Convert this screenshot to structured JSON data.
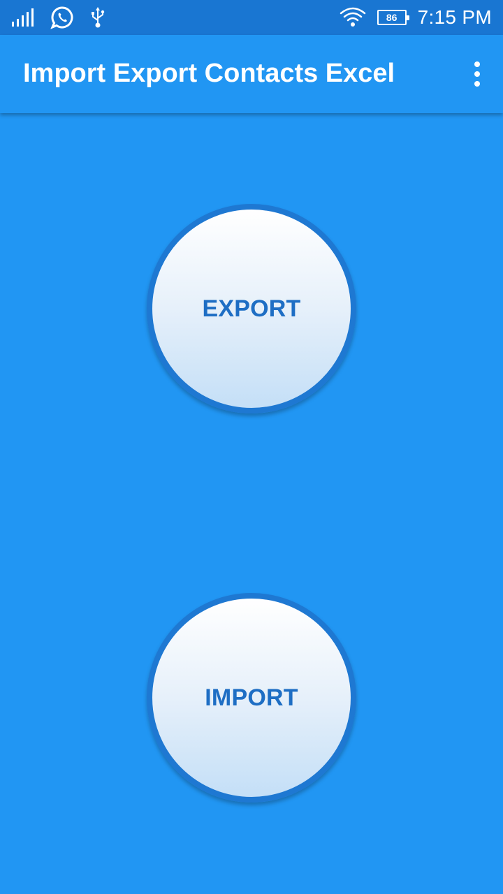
{
  "status_bar": {
    "icons": [
      "signal-icon",
      "whatsapp-icon",
      "usb-icon",
      "wifi-icon"
    ],
    "battery_level": "86",
    "time": "7:15 PM"
  },
  "app_bar": {
    "title": "Import Export Contacts Excel",
    "menu_icon": "overflow-menu-icon"
  },
  "main": {
    "export_label": "EXPORT",
    "import_label": "IMPORT"
  },
  "colors": {
    "status_bar": "#1976D2",
    "primary": "#2196F3",
    "button_border": "#1E78D2",
    "button_text": "#1E6EC4"
  }
}
